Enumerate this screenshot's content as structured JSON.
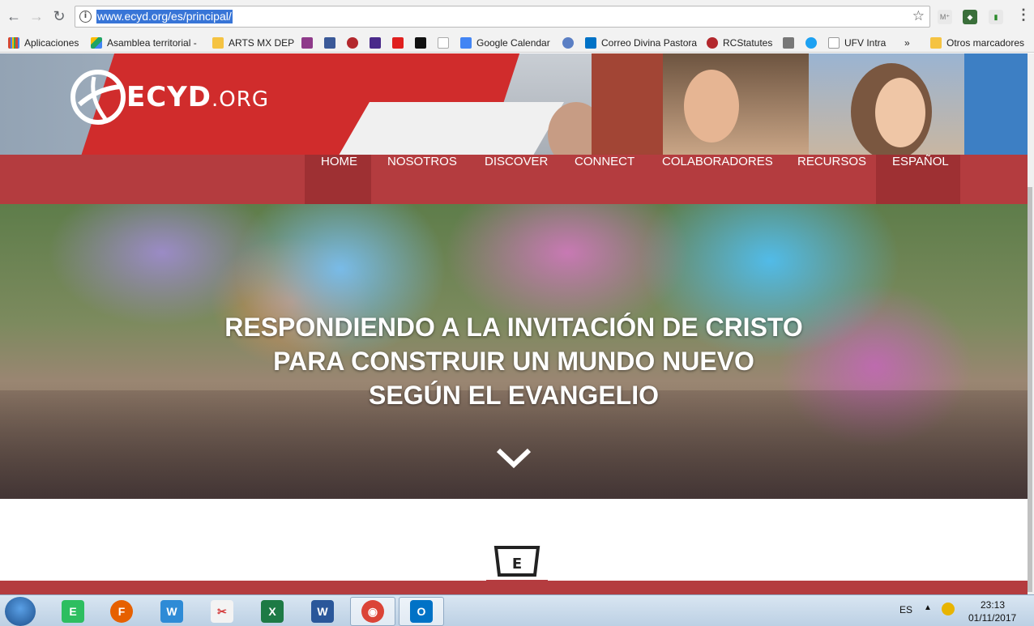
{
  "browser": {
    "url": "www.ecyd.org/es/principal/",
    "bookmarks": [
      {
        "label": "Aplicaciones",
        "color": "#d34836"
      },
      {
        "label": "Asamblea territorial -",
        "color": "#1fa463"
      },
      {
        "label": "ARTS MX DEP",
        "color": "#f5c342"
      },
      {
        "label": "Google Calendar",
        "color": "#4285f4"
      },
      {
        "label": "Correo Divina Pastora",
        "color": "#0072c6"
      },
      {
        "label": "RCStatutes",
        "color": "#b3282d"
      },
      {
        "label": "UFV Intra",
        "color": "#ffffff"
      },
      {
        "label": "»",
        "color": ""
      },
      {
        "label": "Otros marcadores",
        "color": "#f5c342"
      }
    ]
  },
  "site": {
    "logo_main": "ECYD",
    "logo_suffix": ".ORG",
    "nav": [
      "HOME",
      "NOSOTROS",
      "DISCOVER",
      "CONNECT",
      "COLABORADORES",
      "RECURSOS",
      "ESPAÑOL"
    ],
    "hero_lines": [
      "RESPONDIENDO A LA INVITACIÓN DE CRISTO",
      "PARA CONSTRUIR UN MUNDO NUEVO",
      "SEGÚN EL EVANGELIO"
    ],
    "badge_letter": "E",
    "accent": "#b43c3f"
  },
  "taskbar": {
    "apps": [
      {
        "name": "evernote",
        "color": "#2dbe60",
        "glyph": "E"
      },
      {
        "name": "firefox",
        "color": "#e66000",
        "glyph": "F"
      },
      {
        "name": "sticky",
        "color": "#2e8bd6",
        "glyph": "W"
      },
      {
        "name": "snipping",
        "color": "#d43c3c",
        "glyph": "✂"
      },
      {
        "name": "excel",
        "color": "#1d7a45",
        "glyph": "X"
      },
      {
        "name": "word",
        "color": "#2a579a",
        "glyph": "W"
      },
      {
        "name": "chrome",
        "color": "#db4437",
        "glyph": "◉"
      },
      {
        "name": "outlook",
        "color": "#0072c6",
        "glyph": "O"
      }
    ],
    "lang": "ES",
    "time": "23:13",
    "date": "01/11/2017"
  }
}
